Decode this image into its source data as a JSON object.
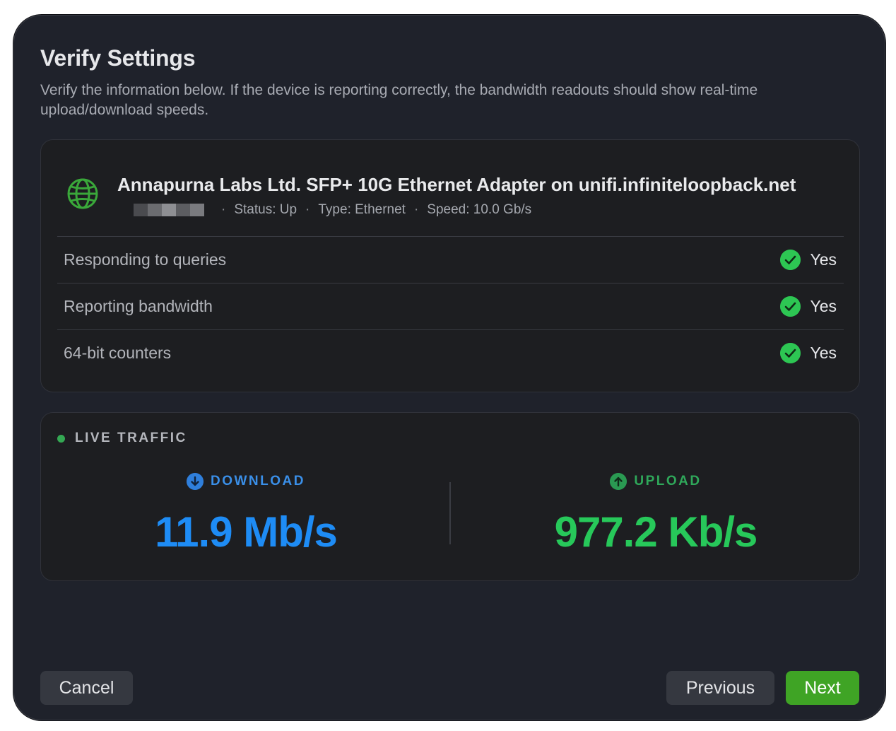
{
  "dialog": {
    "title": "Verify Settings",
    "subtitle": "Verify the information below. If the device is reporting correctly, the bandwidth readouts should show real-time upload/download speeds."
  },
  "device": {
    "icon": "globe-icon",
    "name": "Annapurna Labs Ltd. SFP+ 10G Ethernet Adapter on unifi.infiniteloopback.net",
    "meta": {
      "separator": "·",
      "status": "Status: Up",
      "type": "Type: Ethernet",
      "speed": "Speed: 10.0 Gb/s"
    },
    "checks": [
      {
        "label": "Responding to queries",
        "value": "Yes"
      },
      {
        "label": "Reporting bandwidth",
        "value": "Yes"
      },
      {
        "label": "64-bit counters",
        "value": "Yes"
      }
    ]
  },
  "traffic": {
    "heading": "LIVE TRAFFIC",
    "download": {
      "label": "DOWNLOAD",
      "value": "11.9 Mb/s",
      "color": "#1e8cf5"
    },
    "upload": {
      "label": "UPLOAD",
      "value": "977.2 Kb/s",
      "color": "#27c85a"
    }
  },
  "buttons": {
    "cancel": "Cancel",
    "previous": "Previous",
    "next": "Next"
  },
  "colors": {
    "accent_green": "#3fa425",
    "check_green": "#2dc653",
    "background": "#1f222b"
  }
}
